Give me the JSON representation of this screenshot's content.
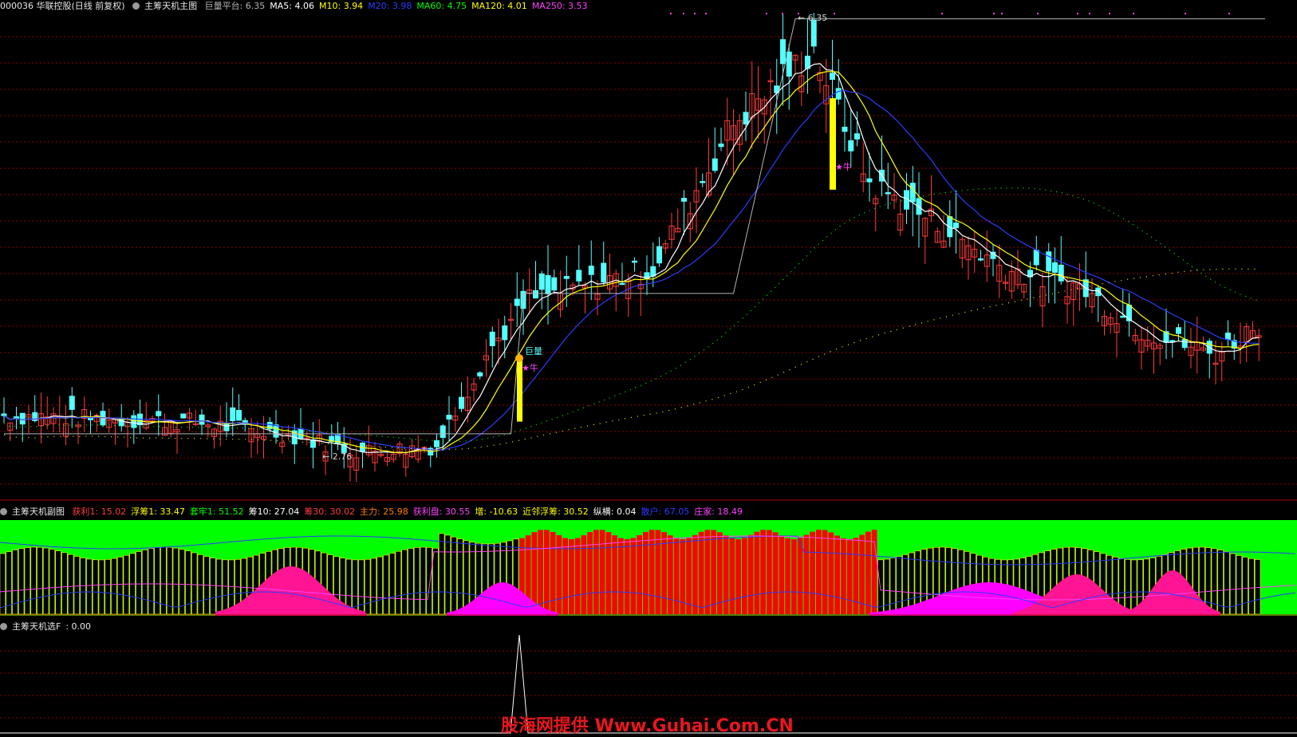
{
  "main_header": {
    "stock": "000036 华联控股(日线 前复权)",
    "indicator": "主筹天机主图",
    "items": [
      {
        "label": "巨量平台: 6.35",
        "color": "#b4b4b4"
      },
      {
        "label": "MA5: 4.06",
        "color": "#ffffff"
      },
      {
        "label": "M10: 3.94",
        "color": "#ffff00"
      },
      {
        "label": "M20: 3.98",
        "color": "#2b3cff"
      },
      {
        "label": "MA60: 4.75",
        "color": "#00ff00"
      },
      {
        "label": "MA120: 4.01",
        "color": "#ffff00"
      },
      {
        "label": "MA250: 3.53",
        "color": "#ff40ff"
      }
    ]
  },
  "annotations": {
    "high": "6.35",
    "low": "2.76",
    "signal_1": "★牛",
    "signal_2": "★牛",
    "signal_giant": "巨量"
  },
  "sub_header": {
    "indicator": "主筹天机副图",
    "items": [
      {
        "label": "获利1: 15.02",
        "color": "#ff3b3b"
      },
      {
        "label": "浮筹1: 33.47",
        "color": "#ffff00"
      },
      {
        "label": "套牢1: 51.52",
        "color": "#00ff00"
      },
      {
        "label": "筹10: 27.04",
        "color": "#ffffff"
      },
      {
        "label": "筹30: 30.02",
        "color": "#ff3b3b"
      },
      {
        "label": "主力: 25.98",
        "color": "#ff7d00"
      },
      {
        "label": "获利盘: 30.55",
        "color": "#ff40ff"
      },
      {
        "label": "增: -10.63",
        "color": "#ffff00"
      },
      {
        "label": "近邻浮筹: 30.52",
        "color": "#ffff00"
      },
      {
        "label": "纵横: 0.04",
        "color": "#ffffff"
      },
      {
        "label": "散户: 67.05",
        "color": "#2b3cff"
      },
      {
        "label": "庄家: 18.49",
        "color": "#ff40ff"
      }
    ]
  },
  "sel_header": {
    "indicator": "主筹天机选F",
    "value": ": 0.00"
  },
  "watermark": "股海网提供 Www.Guhai.Com.CN",
  "colors": {
    "up": "#ff3b3b",
    "down": "#54ffff",
    "grid": "#8b0000",
    "profit": "#ff0000",
    "trapped": "#00ff00",
    "float": "#000000",
    "float_edge": "#ffff00",
    "pink": "#ff1493",
    "magenta": "#ff00ff"
  },
  "chart_data": {
    "type": "candlestick",
    "title": "000036 华联控股(日线 前复权)",
    "price_range": [
      2.4,
      6.4
    ],
    "marked_high": 6.35,
    "marked_low": 2.76,
    "moving_averages": {
      "MA5": 4.06,
      "M10": 3.94,
      "M20": 3.98,
      "MA60": 4.75,
      "MA120": 4.01,
      "MA250": 3.53
    }
  }
}
